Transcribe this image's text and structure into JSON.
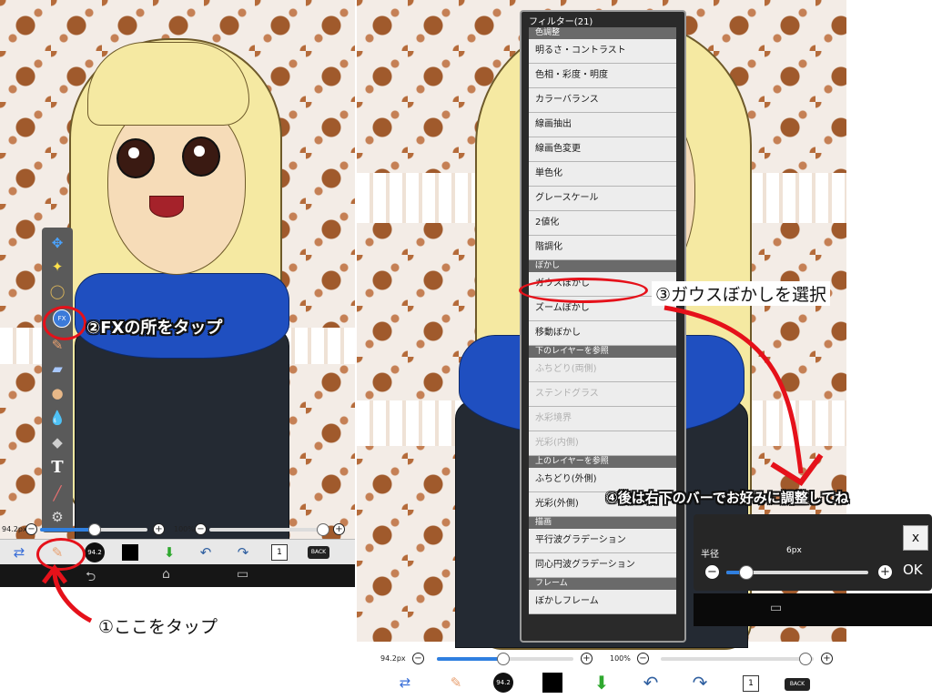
{
  "left": {
    "brush_size": "94.2px",
    "opacity": "100%",
    "size_badge": "94.2",
    "layer_count": "1",
    "back_label": "BACK",
    "tools": [
      "move-icon",
      "magic-wand-icon",
      "lasso-icon",
      "fx-icon",
      "brush-icon",
      "eraser-icon",
      "smudge-icon",
      "bucket-icon",
      "shape-icon",
      "text-icon",
      "pen-icon",
      "settings-icon"
    ],
    "fx_label": "FX",
    "text_tool": "T"
  },
  "callouts": {
    "step1": "①ここをタップ",
    "step2": "②FXの所をタップ",
    "step3": "③ガウスぼかしを選択",
    "step4": "④後は右下のバーでお好みに調整してね"
  },
  "filter_panel": {
    "title": "フィルター(21)",
    "sections": [
      {
        "label": "色調整",
        "items": [
          {
            "label": "明るさ・コントラスト",
            "enabled": true
          },
          {
            "label": "色相・彩度・明度",
            "enabled": true
          },
          {
            "label": "カラーバランス",
            "enabled": true
          },
          {
            "label": "線画抽出",
            "enabled": true
          },
          {
            "label": "線画色変更",
            "enabled": true
          },
          {
            "label": "単色化",
            "enabled": true
          },
          {
            "label": "グレースケール",
            "enabled": true
          },
          {
            "label": "2値化",
            "enabled": true
          },
          {
            "label": "階調化",
            "enabled": true
          }
        ]
      },
      {
        "label": "ぼかし",
        "items": [
          {
            "label": "ガウスぼかし",
            "enabled": true
          },
          {
            "label": "ズームぼかし",
            "enabled": true
          },
          {
            "label": "移動ぼかし",
            "enabled": true
          }
        ]
      },
      {
        "label": "下のレイヤーを参照",
        "items": [
          {
            "label": "ふちどり(両側)",
            "enabled": false
          },
          {
            "label": "ステンドグラス",
            "enabled": false
          },
          {
            "label": "水彩境界",
            "enabled": false
          },
          {
            "label": "光彩(内側)",
            "enabled": false
          }
        ]
      },
      {
        "label": "上のレイヤーを参照",
        "items": [
          {
            "label": "ふちどり(外側)",
            "enabled": true
          },
          {
            "label": "光彩(外側)",
            "enabled": true
          }
        ]
      },
      {
        "label": "描画",
        "items": [
          {
            "label": "平行波グラデーション",
            "enabled": true
          },
          {
            "label": "同心円波グラデーション",
            "enabled": true
          }
        ]
      },
      {
        "label": "フレーム",
        "items": [
          {
            "label": "ぼかしフレーム",
            "enabled": true
          }
        ]
      }
    ]
  },
  "right": {
    "brush_size": "94.2px",
    "opacity": "100%",
    "size_badge": "94.2",
    "layer_count": "1",
    "back_label": "BACK"
  },
  "blur_panel": {
    "label": "半径",
    "value": "6px",
    "close": "x",
    "ok": "OK"
  }
}
